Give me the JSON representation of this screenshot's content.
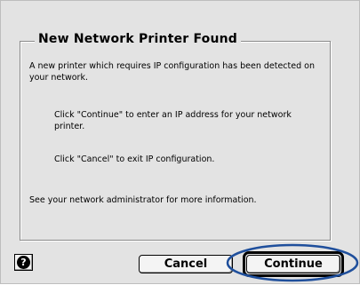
{
  "dialog": {
    "group_title": "New Network Printer Found",
    "paragraphs": [
      "A new printer which requires IP configuration has been detected on your network.",
      "Click \"Continue\" to enter an IP address for your network printer.",
      "Click \"Cancel\" to exit IP configuration.",
      "See your network administrator for more information."
    ]
  },
  "buttons": {
    "help_glyph": "?",
    "help_icon": "question-mark-icon",
    "cancel_label": "Cancel",
    "continue_label": "Continue"
  },
  "annotation": {
    "highlight_color": "#1f4f9c",
    "highlight_target": "continue-button"
  }
}
